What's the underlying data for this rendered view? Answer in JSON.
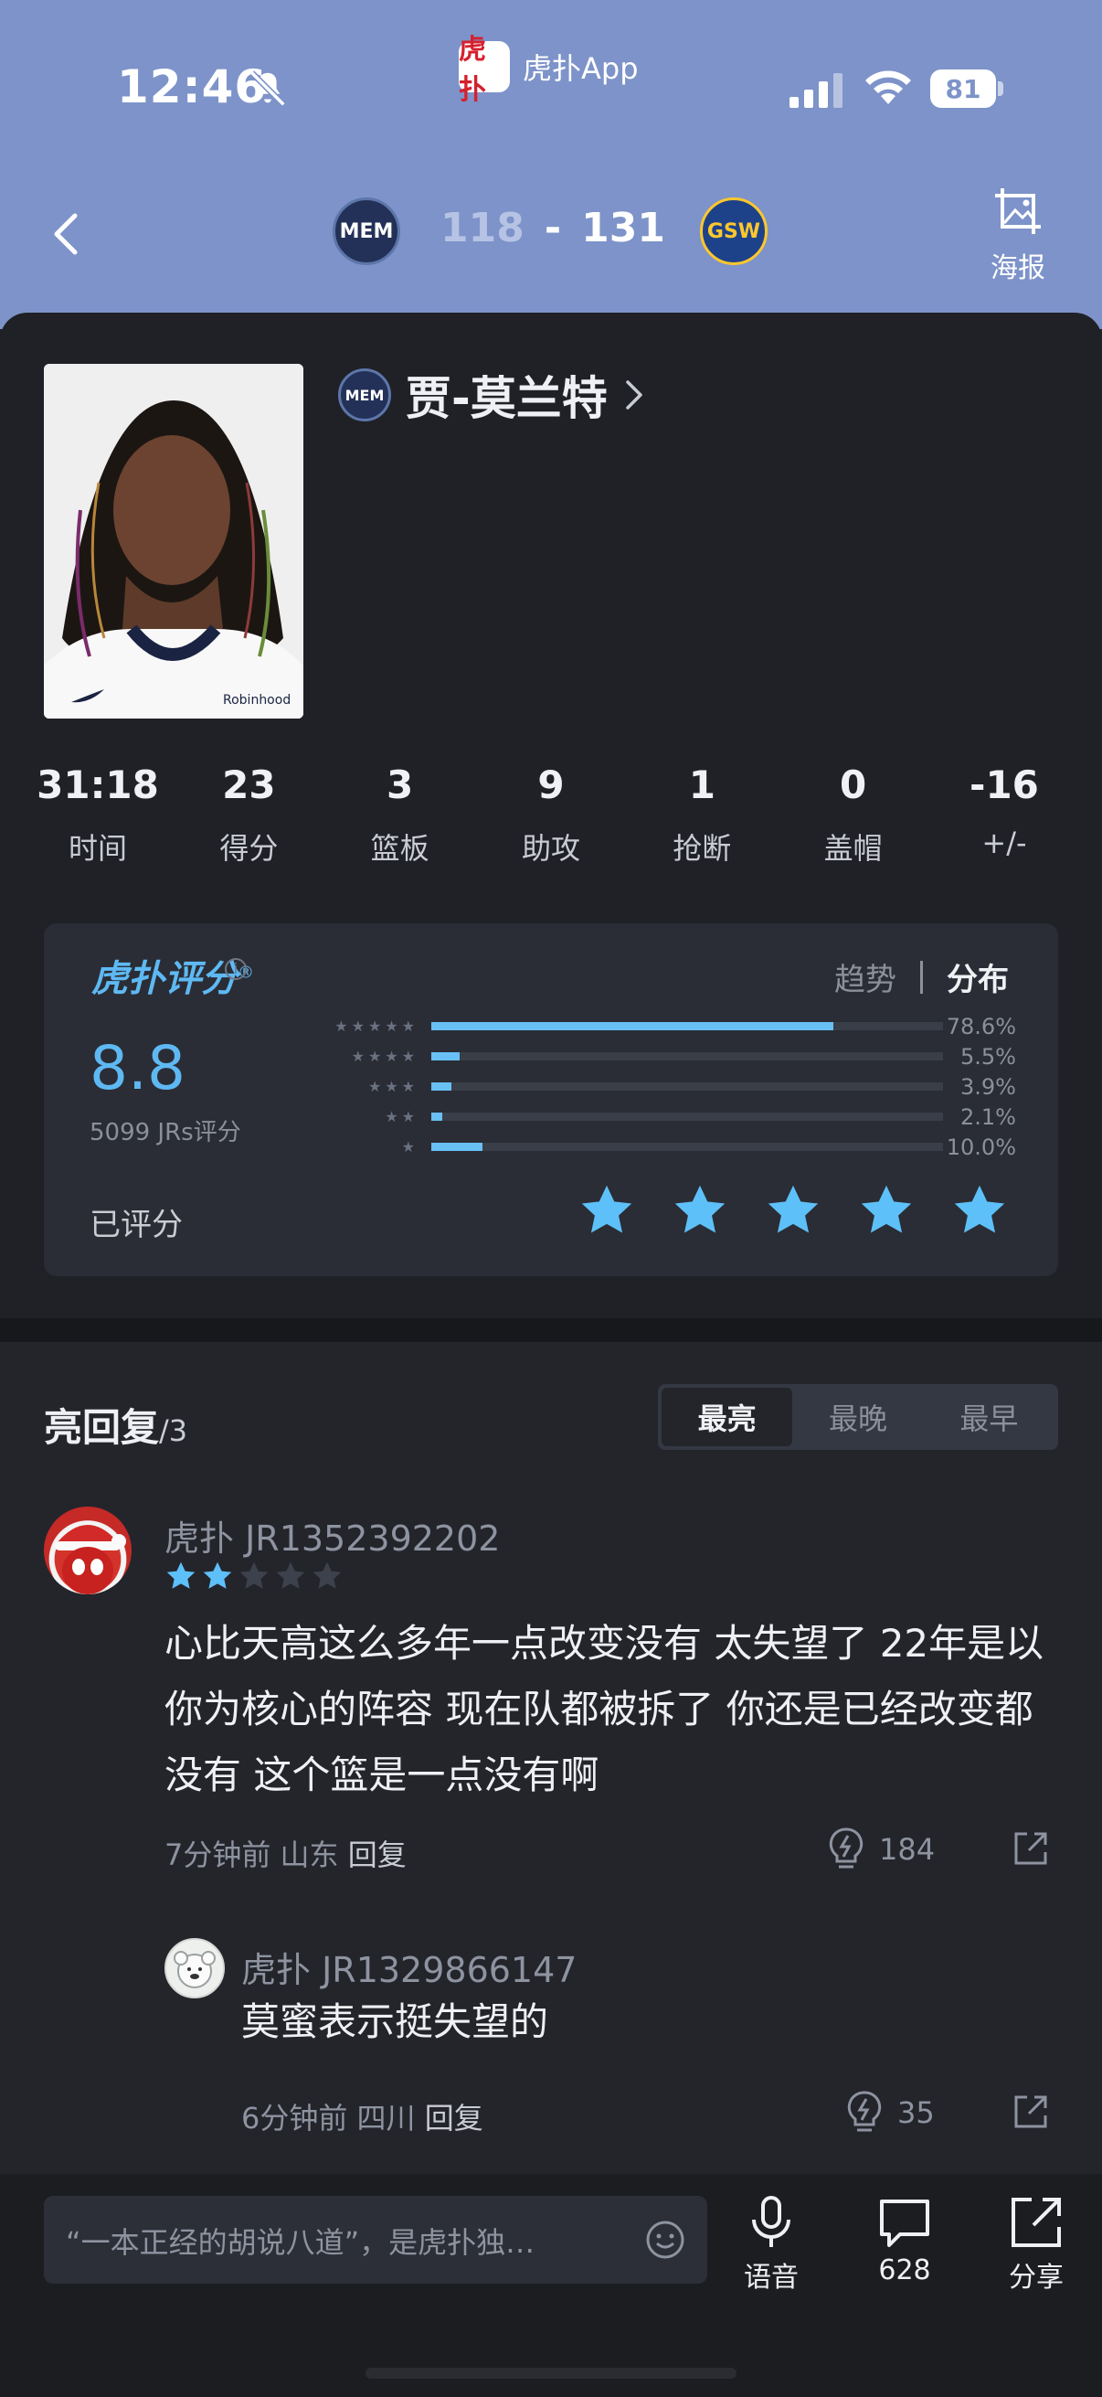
{
  "status_bar": {
    "time": "12:46",
    "app_name": "虎扑App",
    "app_logo_text": "虎扑",
    "battery": "81"
  },
  "header": {
    "home_team": "MEM",
    "away_team": "GSW",
    "home_score": "118",
    "score_sep": "-",
    "away_score": "131",
    "poster_label": "海报"
  },
  "player": {
    "name": "贾-莫兰特",
    "team_badge": "MEM",
    "stats": [
      {
        "value": "31:18",
        "label": "时间"
      },
      {
        "value": "23",
        "label": "得分"
      },
      {
        "value": "3",
        "label": "篮板"
      },
      {
        "value": "9",
        "label": "助攻"
      },
      {
        "value": "1",
        "label": "抢断"
      },
      {
        "value": "0",
        "label": "盖帽"
      },
      {
        "value": "-16",
        "label": "+/-"
      }
    ]
  },
  "rating": {
    "brand": "虎扑评分",
    "brand_mark": "®",
    "tab_trend": "趋势",
    "tab_dist": "分布",
    "score": "8.8",
    "count_text": "5099 JRs评分",
    "rated_label": "已评分",
    "user_rating": 5,
    "distribution": [
      {
        "stars": "★★★★★",
        "pct": "78.6%",
        "fraction": 0.786
      },
      {
        "stars": "★★★★",
        "pct": "5.5%",
        "fraction": 0.055
      },
      {
        "stars": "★★★",
        "pct": "3.9%",
        "fraction": 0.039
      },
      {
        "stars": "★★",
        "pct": "2.1%",
        "fraction": 0.021
      },
      {
        "stars": "★",
        "pct": "10.0%",
        "fraction": 0.1
      }
    ]
  },
  "replies": {
    "title": "亮回复",
    "count": "/3",
    "sort_tabs": [
      "最亮",
      "最晚",
      "最早"
    ],
    "items": [
      {
        "user": "虎扑 JR1352392202",
        "stars": 2,
        "content": "心比天高这么多年一点改变没有 太失望了 22年是以你为核心的阵容 现在队都被拆了 你还是已经改变都没有 这个篮是一点没有啊",
        "time": "7分钟前",
        "location": "山东",
        "reply_label": "回复",
        "likes": "184"
      },
      {
        "user": "虎扑 JR1329866147",
        "content": "莫蜜表示挺失望的",
        "time": "6分钟前",
        "location": "四川",
        "reply_label": "回复",
        "likes": "35"
      }
    ]
  },
  "bottom_bar": {
    "placeholder": "“一本正经的胡说八道”，是虎扑独…",
    "voice_label": "语音",
    "comments_count": "628",
    "share_label": "分享"
  },
  "colors": {
    "header_blue": "#7d93c9",
    "accent_blue": "#5eb9f3",
    "background": "#1f2126"
  }
}
